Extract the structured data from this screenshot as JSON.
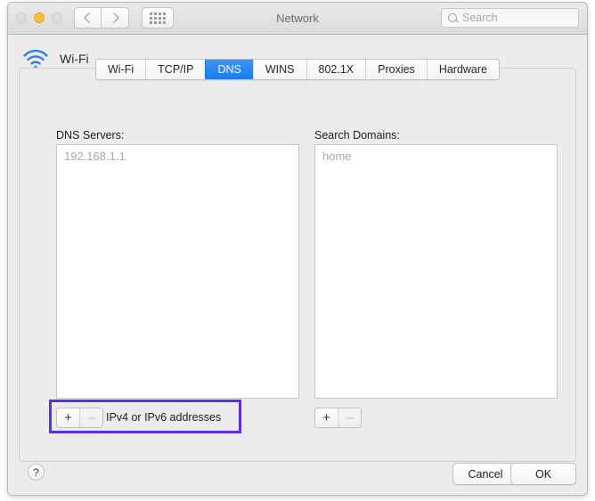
{
  "window": {
    "title": "Network",
    "traffic_lights": [
      {
        "name": "close",
        "state": "inactive",
        "color": "#dcdcdc"
      },
      {
        "name": "minimize",
        "state": "active",
        "color": "#f6bc3d"
      },
      {
        "name": "zoom",
        "state": "inactive",
        "color": "#dcdcdc"
      }
    ],
    "nav": {
      "back_icon": "chevron-left-icon",
      "forward_icon": "chevron-right-icon"
    },
    "show_all_icon": "grid-dots-icon",
    "search": {
      "placeholder": "Search",
      "value": "",
      "icon": "search-icon"
    }
  },
  "service": {
    "icon": "wifi-icon",
    "name": "Wi-Fi"
  },
  "tabs": [
    {
      "label": "Wi-Fi",
      "selected": false
    },
    {
      "label": "TCP/IP",
      "selected": false
    },
    {
      "label": "DNS",
      "selected": true
    },
    {
      "label": "WINS",
      "selected": false
    },
    {
      "label": "802.1X",
      "selected": false
    },
    {
      "label": "Proxies",
      "selected": false
    },
    {
      "label": "Hardware",
      "selected": false
    }
  ],
  "dns_servers": {
    "label": "DNS Servers:",
    "entries": [
      "192.168.1.1"
    ],
    "add_label": "+",
    "remove_label": "–",
    "caption": "IPv4 or IPv6 addresses"
  },
  "search_domains": {
    "label": "Search Domains:",
    "entries": [
      "home"
    ],
    "add_label": "+",
    "remove_label": "–"
  },
  "annotation": {
    "color": "#5b2ee8",
    "target": "dns-servers-add-remove-group"
  },
  "footer": {
    "help_label": "?",
    "cancel_label": "Cancel",
    "ok_label": "OK"
  },
  "colors": {
    "accent_tab": "#177cf3",
    "wifi_icon": "#2f7fe0",
    "annotation": "#5b2ee8",
    "window_bg": "#ececec"
  }
}
